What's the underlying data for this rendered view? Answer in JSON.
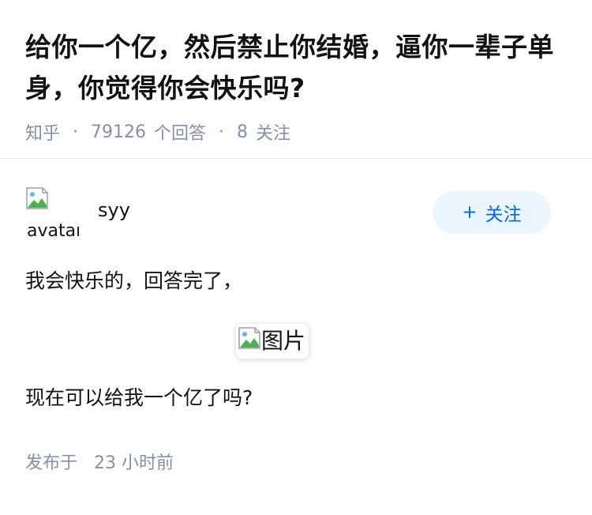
{
  "question": {
    "title": "给你一个亿，然后禁止你结婚，逼你一辈子单身，你觉得你会快乐吗?",
    "source": "知乎",
    "separator": "·",
    "answer_count": "79126",
    "answer_count_label": "个回答",
    "follow_count": "8",
    "follow_count_label": "关注"
  },
  "answer": {
    "author": {
      "avatar_alt": "avatar",
      "name": "syy"
    },
    "follow_button": {
      "icon": "+",
      "label": "关注"
    },
    "paragraphs": [
      "我会快乐的，回答完了，",
      "现在可以给我一个亿了吗?"
    ],
    "image": {
      "alt": "图片"
    },
    "footer": {
      "published_label": "发布于",
      "published_time": "23 小时前"
    }
  },
  "colors": {
    "text": "#121212",
    "muted": "#8590a6",
    "accent": "#0066ff",
    "follow_bg": "#ebf5ff",
    "divider": "#ebebeb"
  }
}
